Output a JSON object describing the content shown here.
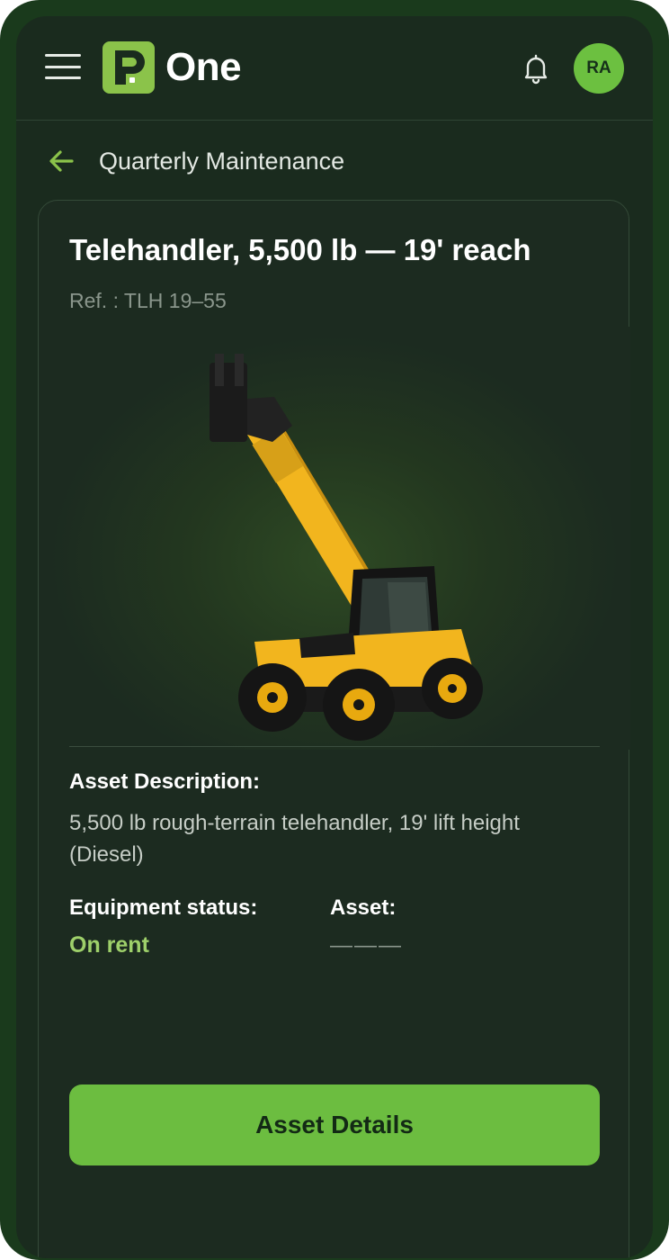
{
  "app": {
    "logo_text": "One",
    "avatar_initials": "RA",
    "accent_color": "#6cbd40",
    "icons": {
      "menu": "hamburger-icon",
      "bell": "bell-icon",
      "back": "arrow-left-icon"
    }
  },
  "breadcrumb": {
    "label": "Quarterly Maintenance"
  },
  "asset": {
    "title": "Telehandler, 5,500 lb — 19' reach",
    "ref": "Ref. : TLH 19–55",
    "image": "telehandler-image",
    "description_label": "Asset Description:",
    "description": "5,500 lb rough-terrain telehandler, 19' lift height (Diesel)",
    "status_label": "Equipment status:",
    "status_value": "On rent",
    "asset_label": "Asset:",
    "asset_value": "———"
  },
  "actions": {
    "details_label": "Asset Details"
  }
}
